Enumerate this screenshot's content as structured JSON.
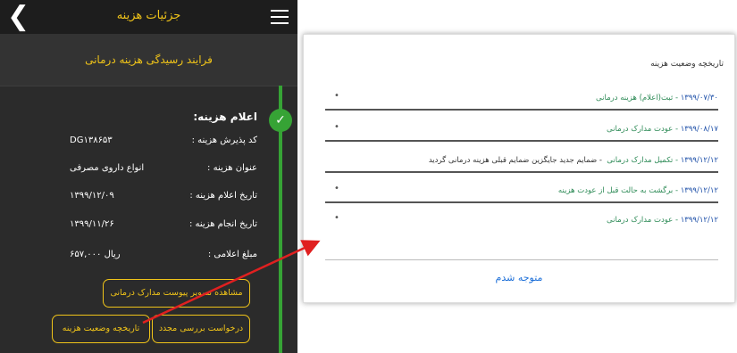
{
  "header": {
    "title": "جزئیات هزینه",
    "back_icon": "chevron-left-icon",
    "menu_icon": "hamburger-menu-icon"
  },
  "process": {
    "title": "فرایند رسیدگی هزینه درمانی",
    "status_icon": "check-icon"
  },
  "details": {
    "section_title": "اعلام هزینه:",
    "rows": [
      {
        "label": "کد پذیرش هزینه :",
        "value": "DG۱۳۸۶۵۳"
      },
      {
        "label": "عنوان هزینه :",
        "value": "انواع داروی مصرفی"
      },
      {
        "label": "تاریخ اعلام هزینه :",
        "value": "۱۳۹۹/۱۲/۰۹"
      },
      {
        "label": "تاریخ انجام هزینه :",
        "value": "۱۳۹۹/۱۱/۲۶"
      },
      {
        "label": "مبلغ اعلامی :",
        "value": "۶۵۷,۰۰۰ ریال"
      }
    ]
  },
  "buttons": {
    "view_docs": "مشاهده تصویر پیوست مدارک درمانی",
    "review_request": "درخواست بررسی مجدد",
    "history": "تاریخچه وضعیت هزینه"
  },
  "dialog": {
    "title": "تاریخچه وضعیت هزینه",
    "items": [
      {
        "date": "۱۳۹۹/۰۷/۳۰",
        "status": " - ثبت(اعلام) هزینه درمانی",
        "extra": "",
        "dot": "•"
      },
      {
        "date": "۱۳۹۹/۰۸/۱۷",
        "status": " - عودت مدارک درمانی",
        "extra": "",
        "dot": "•"
      },
      {
        "date": "۱۳۹۹/۱۲/۱۲",
        "status": " - تکمیل مدارک درمانی",
        "extra": "- ضمایم جدید جایگزین ضمایم قبلی هزینه درمانی گردید",
        "dot": "•"
      },
      {
        "date": "۱۳۹۹/۱۲/۱۲",
        "status": " - برگشت به حالت قبل از عودت هزینه",
        "extra": "",
        "dot": "•"
      },
      {
        "date": "۱۳۹۹/۱۲/۱۲",
        "status": " - عودت مدارک درمانی",
        "extra": "",
        "dot": "•"
      }
    ],
    "ok_label": "متوجه شدم"
  },
  "colors": {
    "accent": "#f0c419",
    "success": "#36a335",
    "link": "#1d6fd8",
    "arrow": "#e02020"
  }
}
